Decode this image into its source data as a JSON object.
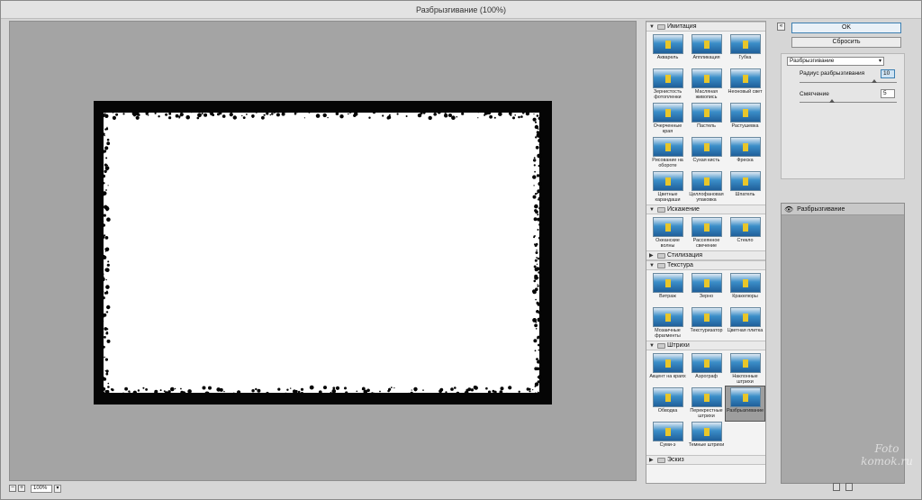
{
  "window": {
    "title": "Разбрызгивание (100%)"
  },
  "canvas": {
    "zoom": "100%",
    "zoom_out": "−",
    "zoom_in": "+",
    "dropdown": "▾"
  },
  "gallery": {
    "sections": [
      {
        "name": "Имитация",
        "expanded": true,
        "items": [
          {
            "label": "Акварель"
          },
          {
            "label": "Аппликация"
          },
          {
            "label": "Губка"
          },
          {
            "label": "Зернистость фотопленки"
          },
          {
            "label": "Масляная живопись"
          },
          {
            "label": "Неоновый свет"
          },
          {
            "label": "Очерченные края"
          },
          {
            "label": "Пастель"
          },
          {
            "label": "Растушевка"
          },
          {
            "label": "Рисование на обороте"
          },
          {
            "label": "Сухая кисть"
          },
          {
            "label": "Фреска"
          },
          {
            "label": "Цветные карандаши"
          },
          {
            "label": "Целлофановая упаковка"
          },
          {
            "label": "Шпатель"
          }
        ]
      },
      {
        "name": "Искажение",
        "expanded": true,
        "items": [
          {
            "label": "Океанские волны"
          },
          {
            "label": "Рассеянное свечение"
          },
          {
            "label": "Стекло"
          }
        ]
      },
      {
        "name": "Стилизация",
        "expanded": false,
        "items": []
      },
      {
        "name": "Текстура",
        "expanded": true,
        "items": [
          {
            "label": "Витраж"
          },
          {
            "label": "Зерно"
          },
          {
            "label": "Кракелюры"
          },
          {
            "label": "Мозаичные фрагменты"
          },
          {
            "label": "Текстуризатор"
          },
          {
            "label": "Цветная плитка"
          }
        ]
      },
      {
        "name": "Штрихи",
        "expanded": true,
        "items": [
          {
            "label": "Акцент на краях"
          },
          {
            "label": "Аэрограф"
          },
          {
            "label": "Наклонные штрихи"
          },
          {
            "label": "Обводка"
          },
          {
            "label": "Перекрестные штрихи"
          },
          {
            "label": "Разбрызгивание",
            "selected": true
          },
          {
            "label": "Суми-э"
          },
          {
            "label": "Темные штрихи"
          }
        ]
      },
      {
        "name": "Эскиз",
        "expanded": false,
        "items": []
      }
    ]
  },
  "panel": {
    "collapse": "«",
    "ok": "OK",
    "reset": "Сбросить",
    "filter_select": "Разбрызгивание",
    "params": [
      {
        "label": "Радиус разбрызгивания",
        "value": "10",
        "slider": 0.77
      },
      {
        "label": "Смягчение",
        "value": "5",
        "slider": 0.33
      }
    ],
    "layers": [
      {
        "name": "Разбрызгивание",
        "visible": true
      }
    ]
  },
  "watermark": {
    "line1": "Foto",
    "line2": "komok.ru"
  },
  "colors": {
    "thumb_sky": "#3b8ec8",
    "thumb_sea": "#1f5f9a",
    "thumb_boat": "#e8c62a",
    "selected_cell": "#9e9e9e",
    "ok_border": "#3c7fb1"
  }
}
